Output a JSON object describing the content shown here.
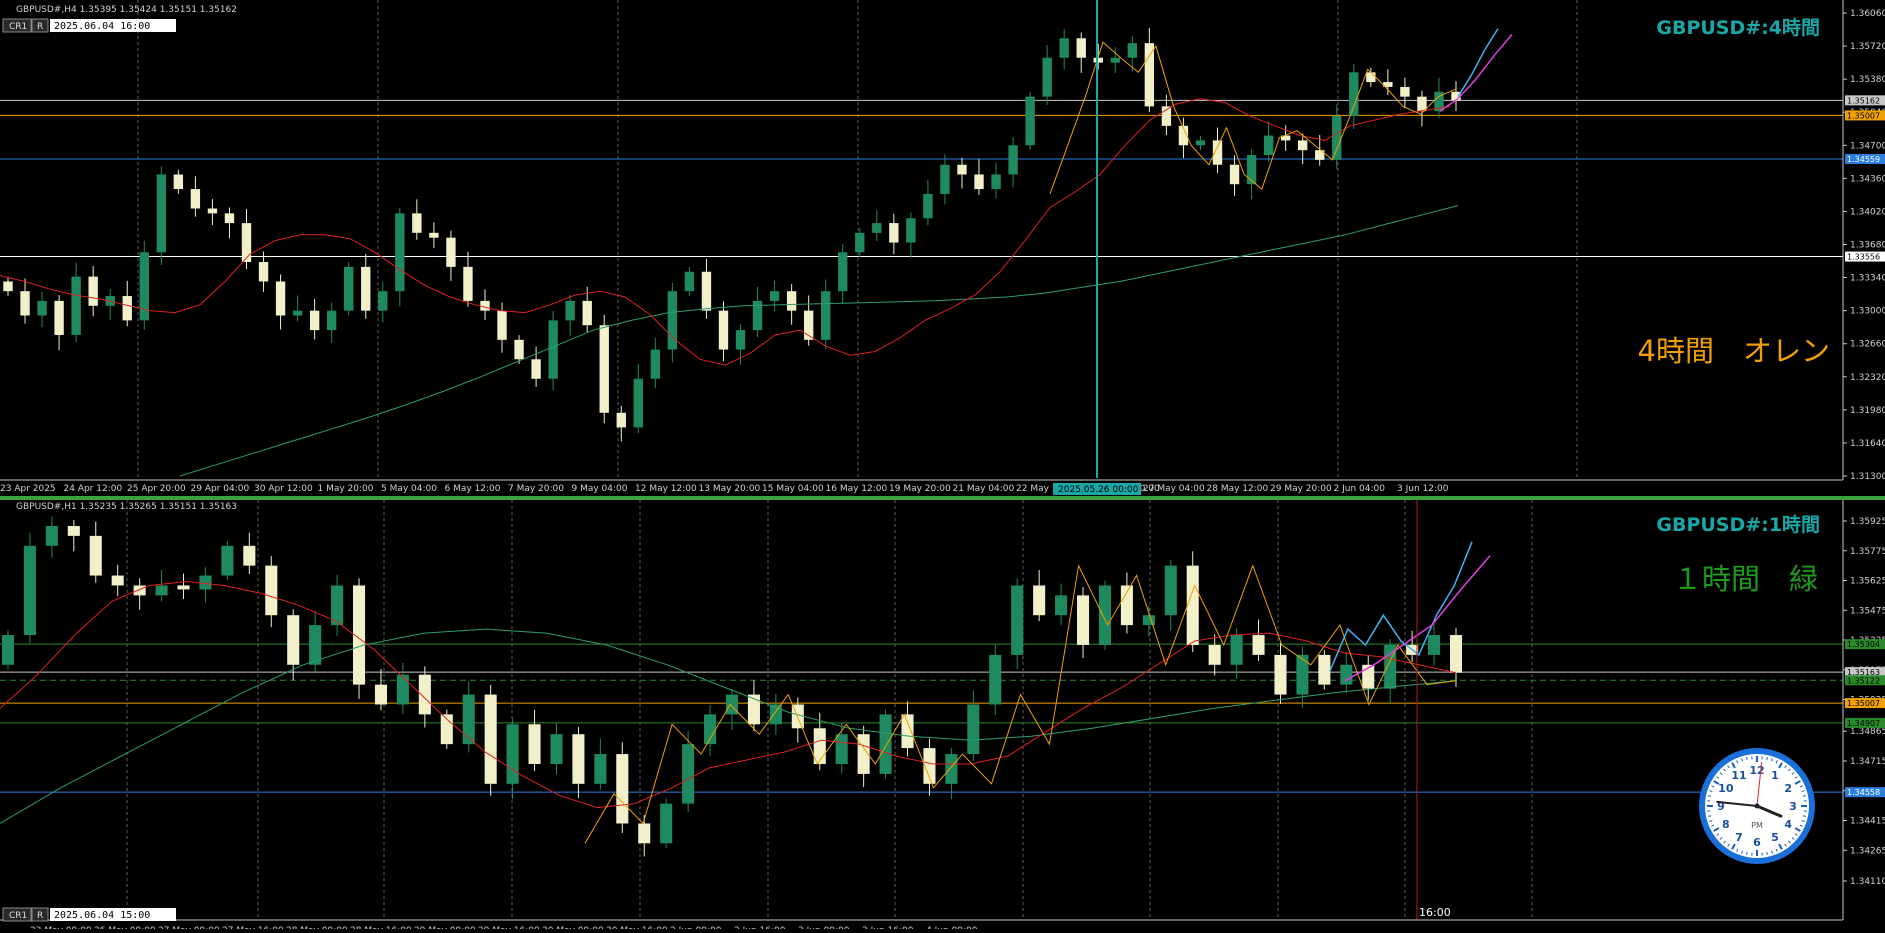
{
  "colors": {
    "background": "#000000",
    "grid": "#8a8a8a",
    "bull": "#1f8a5f",
    "bear": "#f2f0c8",
    "ma_short": "#e02020",
    "ma_long": "#2e9e6a",
    "zigzag": "#f0a000",
    "forecast_blue": "#3fb3f0",
    "forecast_magenta": "#e040e0",
    "level_orange": "#f0a000",
    "level_blue": "#2a7fe0",
    "level_white": "#ffffff",
    "level_green": "#2a8a2a",
    "title_h4": "#18a8a8",
    "title_h1": "#18a8a8",
    "note_orange": "#f0a000",
    "note_green": "#1e9a1e",
    "divider": "#3aa33a"
  },
  "h4": {
    "info": "GBPUSD#,H4  1.35395 1.35424 1.35151 1.35162",
    "cr_button": "CR1",
    "r_button": "R",
    "date_box": "2025.06.04 16:00",
    "title": "GBPUSD#:4時間",
    "note": "4時間　オレン",
    "x_labels": [
      "23 Apr 2025",
      "24 Apr 12:00",
      "25 Apr 20:00",
      "29 Apr 04:00",
      "30 Apr 12:00",
      "1 May 20:00",
      "5 May 04:00",
      "6 May 12:00",
      "7 May 20:00",
      "9 May 04:00",
      "12 May 12:00",
      "13 May 20:00",
      "15 May 04:00",
      "16 May 12:00",
      "19 May 20:00",
      "21 May 04:00",
      "22 May",
      "2025.05.26 00:00",
      "27 May 04:00",
      "28 May 12:00",
      "29 May 20:00",
      "2 Jun 04:00",
      "3 Jun 12:00"
    ],
    "cursor_label": "2025.05.26 00:00",
    "price_ticks": [
      "1.36060",
      "1.35720",
      "1.35380",
      "1.35040",
      "1.34700",
      "1.34360",
      "1.34020",
      "1.33680",
      "1.33340",
      "1.33000",
      "1.32660",
      "1.32320",
      "1.31980",
      "1.31640",
      "1.31300"
    ],
    "price_ticks_num": [
      1.3606,
      1.3572,
      1.3538,
      1.3504,
      1.347,
      1.3436,
      1.3402,
      1.3368,
      1.3334,
      1.33,
      1.3266,
      1.3232,
      1.3198,
      1.3164,
      1.313
    ],
    "levels": [
      {
        "label": "1.35162",
        "value": 1.35162,
        "color": "#c8c8c8",
        "box": "#c8c8c8",
        "text": "#000000"
      },
      {
        "label": "1.35007",
        "value": 1.35007,
        "color": "#f0a000",
        "box": "#f0a000",
        "text": "#000000"
      },
      {
        "label": "1.34559",
        "value": 1.34559,
        "color": "#2a7fe0",
        "box": "#2a7fe0",
        "text": "#ffffff"
      },
      {
        "label": "1.33556",
        "value": 1.33556,
        "color": "#ffffff",
        "box": "#ffffff",
        "text": "#000000"
      }
    ],
    "ma_short": [
      1.3336,
      1.333,
      1.3322,
      1.3316,
      1.3312,
      1.3306,
      1.33,
      1.3298,
      1.3306,
      1.333,
      1.3358,
      1.3372,
      1.3378,
      1.3378,
      1.3374,
      1.336,
      1.3342,
      1.3326,
      1.3314,
      1.3306,
      1.33,
      1.3298,
      1.3306,
      1.3316,
      1.332,
      1.3314,
      1.3296,
      1.327,
      1.325,
      1.3244,
      1.3256,
      1.3275,
      1.328,
      1.3264,
      1.3254,
      1.3258,
      1.3272,
      1.329,
      1.3302,
      1.3316,
      1.334,
      1.3372,
      1.3406,
      1.3422,
      1.344,
      1.347,
      1.3496,
      1.3512,
      1.3518,
      1.3514,
      1.35,
      1.349,
      1.348,
      1.3475,
      1.349,
      1.3496,
      1.3502,
      1.3506,
      1.351
    ],
    "ma_long": [
      1.313,
      1.3142,
      1.3154,
      1.3166,
      1.3178,
      1.319,
      1.3203,
      1.3217,
      1.3232,
      1.3248,
      1.3264,
      1.328,
      1.329,
      1.3298,
      1.3302,
      1.3305,
      1.3306,
      1.3307,
      1.3308,
      1.3309,
      1.331,
      1.3312,
      1.3314,
      1.3318,
      1.3324,
      1.333,
      1.3338,
      1.3346,
      1.3354,
      1.3362,
      1.337,
      1.3378,
      1.3388,
      1.3398,
      1.3408
    ],
    "zigzag": [
      [
        1.342,
        1.347,
        1.352,
        1.3576,
        1.356,
        1.3545,
        1.3572,
        1.351,
        1.347,
        1.345,
        1.3488,
        1.344,
        1.3425,
        1.3478,
        1.3485,
        1.347,
        1.3455,
        1.35,
        1.3548,
        1.353,
        1.351,
        1.3502,
        1.352,
        1.3528
      ]
    ],
    "forecast_blue": [
      1.352,
      1.3542,
      1.3568,
      1.359
    ],
    "forecast_magenta": [
      1.3505,
      1.3518,
      1.3538,
      1.3562,
      1.3584
    ]
  },
  "h1": {
    "info": "GBPUSD#,H1  1.35235 1.35265 1.35151 1.35163",
    "cr_button": "CR1",
    "r_button": "R",
    "date_box": "2025.06.04 15:00",
    "title": "GBPUSD#:1時間",
    "note": "１時間　緑",
    "cursor_time": "16:00",
    "price_ticks": [
      "1.35925",
      "1.35775",
      "1.35625",
      "1.35475",
      "1.35325",
      "1.35175",
      "1.35025",
      "1.34865",
      "1.34715",
      "1.34565",
      "1.34415",
      "1.34265",
      "1.34110"
    ],
    "price_ticks_num": [
      1.35925,
      1.35775,
      1.35625,
      1.35475,
      1.35325,
      1.35175,
      1.35025,
      1.34865,
      1.34715,
      1.34565,
      1.34415,
      1.34265,
      1.3411
    ],
    "levels": [
      {
        "label": "1.35304",
        "value": 1.35304,
        "color": "#2a8a2a",
        "box": "#2a8a2a",
        "text": "#000000",
        "dash": false
      },
      {
        "label": "1.35163",
        "value": 1.35163,
        "color": "#c8c8c8",
        "box": "#c8c8c8",
        "text": "#000000",
        "dash": false
      },
      {
        "label": "1.35122",
        "value": 1.35122,
        "color": "#2a8a2a",
        "box": "#2a8a2a",
        "text": "#000000",
        "dash": true
      },
      {
        "label": "1.35007",
        "value": 1.35007,
        "color": "#f0a000",
        "box": "#f0a000",
        "text": "#000000",
        "dash": false
      },
      {
        "label": "1.34907",
        "value": 1.34907,
        "color": "#2a8a2a",
        "box": "#2a8a2a",
        "text": "#000000",
        "dash": false
      },
      {
        "label": "1.34558",
        "value": 1.34558,
        "color": "#2a7fe0",
        "box": "#2a7fe0",
        "text": "#ffffff",
        "dash": false
      }
    ],
    "ma_short": [
      1.3498,
      1.3515,
      1.3535,
      1.3552,
      1.356,
      1.3562,
      1.356,
      1.3556,
      1.355,
      1.3542,
      1.3528,
      1.351,
      1.3492,
      1.3476,
      1.3464,
      1.3454,
      1.3448,
      1.345,
      1.3458,
      1.3468,
      1.3472,
      1.3476,
      1.3482,
      1.348,
      1.3474,
      1.347,
      1.347,
      1.3474,
      1.3486,
      1.3498,
      1.3508,
      1.352,
      1.3532,
      1.3535,
      1.3536,
      1.3532,
      1.3526,
      1.3524,
      1.352,
      1.3516
    ],
    "ma_long": [
      1.344,
      1.3458,
      1.3474,
      1.349,
      1.3506,
      1.352,
      1.353,
      1.3536,
      1.3538,
      1.3536,
      1.353,
      1.352,
      1.3508,
      1.3496,
      1.3488,
      1.3484,
      1.3482,
      1.3484,
      1.3488,
      1.3493,
      1.3498,
      1.3502,
      1.3506,
      1.3509,
      1.3512
    ],
    "zigzag": [
      1.343,
      1.3455,
      1.344,
      1.349,
      1.3475,
      1.35,
      1.3485,
      1.3505,
      1.347,
      1.349,
      1.347,
      1.3495,
      1.3458,
      1.3475,
      1.346,
      1.3505,
      1.348,
      1.357,
      1.354,
      1.3565,
      1.352,
      1.356,
      1.353,
      1.357,
      1.353,
      1.352,
      1.354,
      1.35,
      1.353,
      1.351,
      1.3512
    ],
    "forecast_blue": [
      1.3517,
      1.3538,
      1.353,
      1.3545,
      1.3532,
      1.3525,
      1.3545,
      1.356,
      1.3582
    ],
    "forecast_magenta": [
      1.3512,
      1.352,
      1.353,
      1.354,
      1.3558,
      1.3575
    ],
    "x_labels": [
      "23 May 09:00",
      "26 May 09:00",
      "27 May 09:00",
      "27 May 16:00",
      "28 May 09:00",
      "28 May 16:00",
      "29 May 09:00",
      "29 May 16:00",
      "30 May 09:00",
      "30 May 16:00",
      "2 Jun 09:00",
      "2 Jun 16:00",
      "3 Jun 09:00",
      "3 Jun 16:00",
      "4 Jun 09:00"
    ]
  },
  "clock": {
    "numerals": [
      "12",
      "1",
      "2",
      "3",
      "4",
      "5",
      "6",
      "7",
      "8",
      "9",
      "10",
      "11"
    ],
    "ampm": "PM",
    "hour": 3,
    "minute": 46,
    "second": 1
  },
  "chart_data": [
    {
      "type": "candlestick",
      "title": "GBPUSD#:4時間",
      "timeframe": "H4",
      "ylim": [
        1.313,
        1.3606
      ],
      "last": {
        "open": 1.35395,
        "high": 1.35424,
        "low": 1.35151,
        "close": 1.35162
      },
      "closes_approx": [
        1.332,
        1.3295,
        1.331,
        1.3275,
        1.3335,
        1.3305,
        1.3315,
        1.329,
        1.336,
        1.344,
        1.3425,
        1.3405,
        1.34,
        1.339,
        1.335,
        1.333,
        1.3295,
        1.33,
        1.328,
        1.33,
        1.3345,
        1.33,
        1.332,
        1.34,
        1.338,
        1.3375,
        1.3345,
        1.331,
        1.33,
        1.327,
        1.325,
        1.323,
        1.329,
        1.331,
        1.3285,
        1.3195,
        1.318,
        1.323,
        1.326,
        1.332,
        1.334,
        1.33,
        1.326,
        1.328,
        1.331,
        1.332,
        1.33,
        1.327,
        1.332,
        1.336,
        1.338,
        1.339,
        1.337,
        1.3395,
        1.342,
        1.345,
        1.344,
        1.3425,
        1.344,
        1.347,
        1.352,
        1.356,
        1.358,
        1.356,
        1.3555,
        1.356,
        1.3575,
        1.351,
        1.349,
        1.347,
        1.3475,
        1.345,
        1.343,
        1.346,
        1.348,
        1.3475,
        1.3465,
        1.3455,
        1.35,
        1.3545,
        1.3535,
        1.353,
        1.352,
        1.3505,
        1.3525,
        1.3516
      ],
      "levels": [
        1.35162,
        1.35007,
        1.34559,
        1.33556
      ]
    },
    {
      "type": "candlestick",
      "title": "GBPUSD#:1時間",
      "timeframe": "H1",
      "ylim": [
        1.3411,
        1.36
      ],
      "last": {
        "open": 1.35235,
        "high": 1.35265,
        "low": 1.35151,
        "close": 1.35163
      },
      "closes_approx": [
        1.3535,
        1.358,
        1.359,
        1.3585,
        1.3565,
        1.356,
        1.3555,
        1.356,
        1.3558,
        1.3565,
        1.358,
        1.357,
        1.3545,
        1.352,
        1.354,
        1.356,
        1.351,
        1.35,
        1.3515,
        1.3495,
        1.348,
        1.3505,
        1.346,
        1.349,
        1.347,
        1.3485,
        1.346,
        1.3475,
        1.344,
        1.343,
        1.345,
        1.348,
        1.3495,
        1.3505,
        1.349,
        1.35,
        1.3488,
        1.347,
        1.3485,
        1.3465,
        1.3495,
        1.3478,
        1.346,
        1.3475,
        1.35,
        1.3525,
        1.356,
        1.3545,
        1.3555,
        1.353,
        1.356,
        1.354,
        1.3545,
        1.357,
        1.353,
        1.352,
        1.3535,
        1.3525,
        1.3505,
        1.3525,
        1.351,
        1.352,
        1.3508,
        1.353,
        1.3525,
        1.3535,
        1.3516
      ],
      "levels": [
        1.35304,
        1.35163,
        1.35122,
        1.35007,
        1.34907,
        1.34558
      ]
    }
  ]
}
